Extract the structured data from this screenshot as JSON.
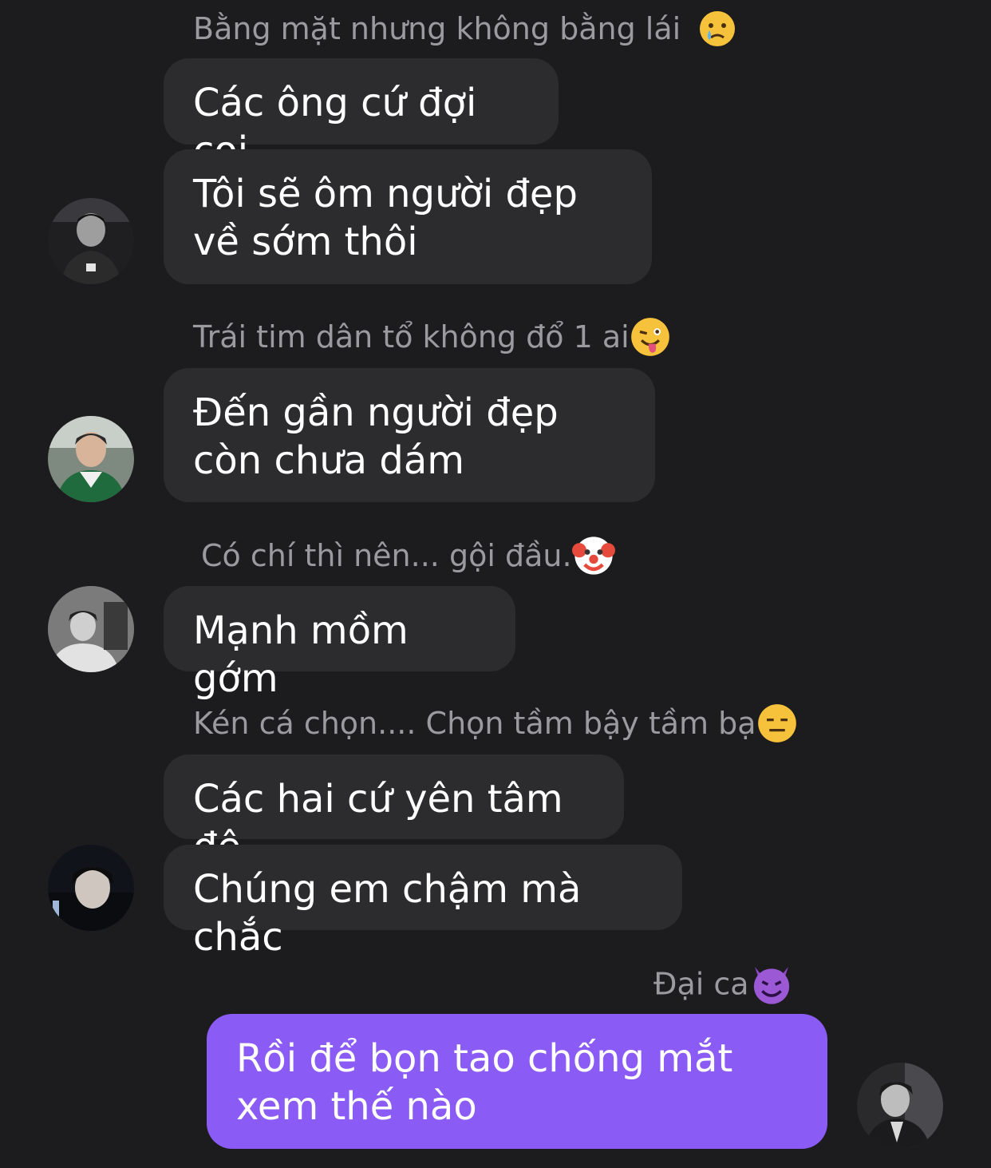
{
  "messages": [
    {
      "sender": "Bằng mặt nhưng không bằng lái",
      "sender_emoji": "crying-face-icon",
      "bubbles": [
        "Các ông cứ đợi coi",
        "Tôi sẽ ôm người đẹp về sớm thôi"
      ]
    },
    {
      "sender": "Trái tim dân tổ không đổ 1 ai",
      "sender_emoji": "winking-tongue-face-icon",
      "bubbles": [
        "Đến gần người đẹp còn chưa dám"
      ]
    },
    {
      "sender": "Có chí thì nên... gội đầu.",
      "sender_emoji": "clown-face-icon",
      "bubbles": [
        "Mạnh mồm gớm"
      ]
    },
    {
      "sender": "Kén cá chọn.... Chọn tầm bậy tầm bạ",
      "sender_emoji": "expressionless-face-icon",
      "bubbles": [
        "Các hai cứ yên tâm đê",
        "Chúng em chậm mà chắc"
      ]
    },
    {
      "sender": "Đại ca",
      "sender_emoji": "smiling-devil-icon",
      "bubbles": [
        "Rồi để bọn tao chống mắt xem thế nào"
      ],
      "outgoing": true
    }
  ],
  "colors": {
    "background": "#1c1c1e",
    "incoming_bubble": "#2c2c2e",
    "outgoing_bubble": "#8a5cf5",
    "sender_text": "#9a9a9f"
  }
}
